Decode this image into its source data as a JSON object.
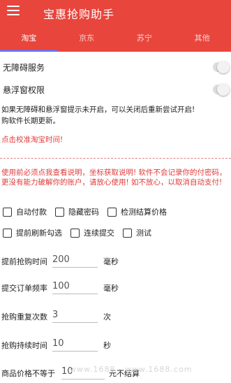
{
  "app": {
    "title": "宝惠抢购助手"
  },
  "tabs": [
    {
      "label": "淘宝",
      "active": true
    },
    {
      "label": "京东",
      "active": false
    },
    {
      "label": "苏宁",
      "active": false
    },
    {
      "label": "其他",
      "active": false
    }
  ],
  "switches": [
    {
      "label": "无障碍服务",
      "on": false
    },
    {
      "label": "悬浮窗权限",
      "on": false
    }
  ],
  "notes": {
    "permission_tip": "如果无障碍和悬浮窗提示未开启，可以关闭后重新尝试开启!",
    "update_tip": "购软件长期更新。",
    "calibrate_link": "点击校准淘宝时间!",
    "usage_warning": "使用前必须点我查看说明，坐标获取说明! 软件不会记录你的付密码，更没有能力破解你的账户，请放心使用! 如不放心，以取消自动支付!"
  },
  "options": [
    {
      "label": "自动付款",
      "checked": false
    },
    {
      "label": "隐藏密码",
      "checked": false
    },
    {
      "label": "检测结算价格",
      "checked": false
    },
    {
      "label": "提前刷新勾选",
      "checked": false
    },
    {
      "label": "连续提交",
      "checked": false
    },
    {
      "label": "测试",
      "checked": false
    }
  ],
  "fields": [
    {
      "label": "提前抢购时间",
      "value": "200",
      "unit": "毫秒"
    },
    {
      "label": "提交订单频率",
      "value": "100",
      "unit": "毫秒"
    },
    {
      "label": "抢购重复次数",
      "value": "3",
      "unit": "次"
    },
    {
      "label": "抢购持续时间",
      "value": "10",
      "unit": "秒"
    },
    {
      "label": "商品价格不等于",
      "value": "10",
      "unit": "元不结算"
    }
  ],
  "watermark": "www.1688  ·  www.1688.com",
  "colors": {
    "primary": "#e8453c",
    "tab_indicator": "#6f6fe0",
    "warning_text": "#e03a3a"
  }
}
